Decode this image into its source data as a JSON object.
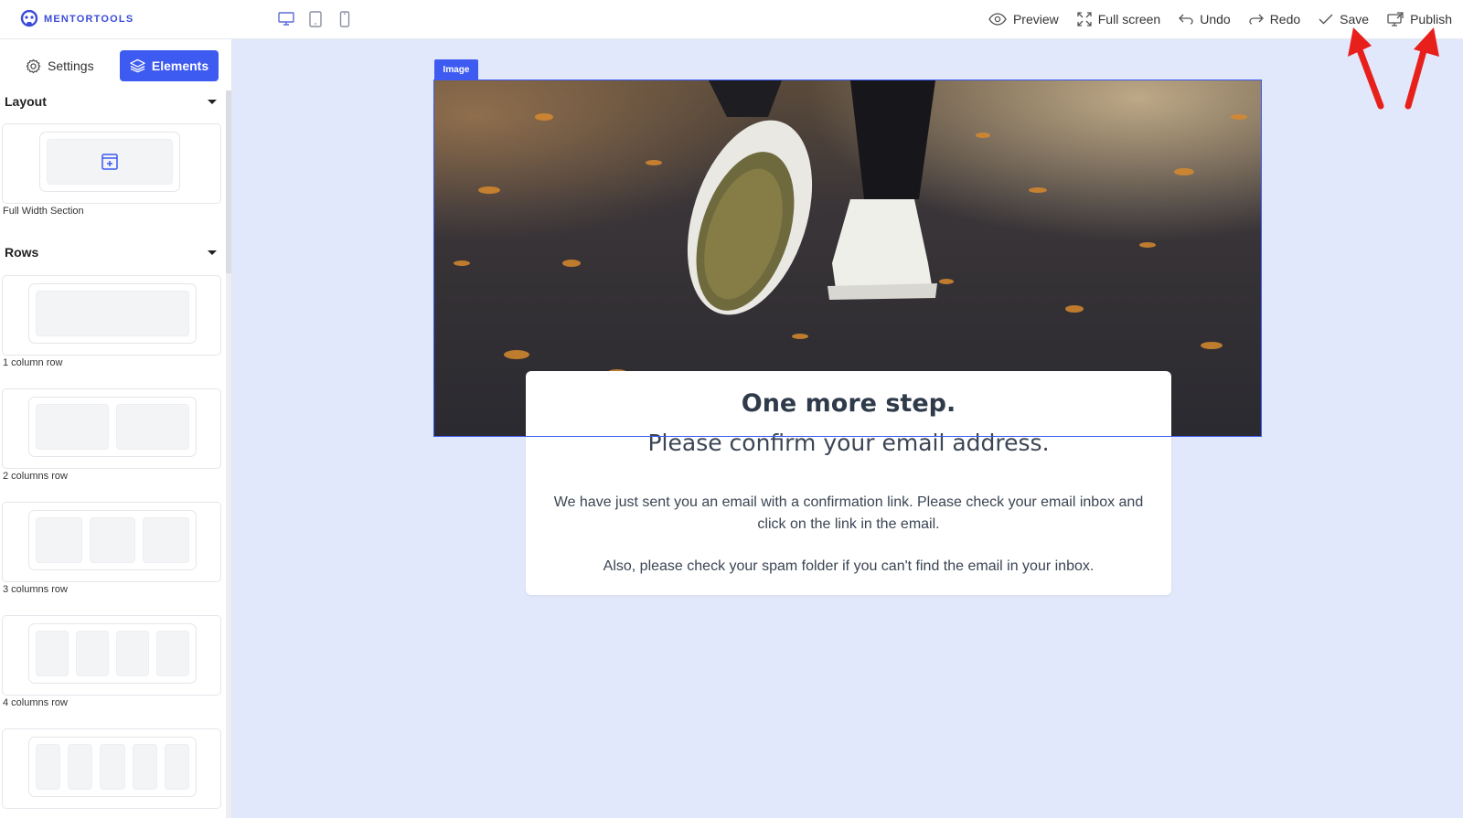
{
  "app": {
    "logo_text": "MENTORTOOLS",
    "accent": "#3d5af1"
  },
  "devices": [
    {
      "name": "desktop-icon",
      "active": true
    },
    {
      "name": "tablet-icon",
      "active": false
    },
    {
      "name": "mobile-icon",
      "active": false
    }
  ],
  "toolbar": {
    "preview": "Preview",
    "fullscreen": "Full screen",
    "undo": "Undo",
    "redo": "Redo",
    "save": "Save",
    "publish": "Publish"
  },
  "sidebar": {
    "tabs": {
      "settings": "Settings",
      "elements": "Elements"
    },
    "layout": {
      "title": "Layout",
      "items": [
        {
          "label": "Full Width Section"
        }
      ]
    },
    "rows": {
      "title": "Rows",
      "items": [
        {
          "label": "1 column row",
          "columns": 1
        },
        {
          "label": "2 columns row",
          "columns": 2
        },
        {
          "label": "3 columns row",
          "columns": 3
        },
        {
          "label": "4 columns row",
          "columns": 4
        },
        {
          "label": "",
          "columns": 5
        }
      ]
    }
  },
  "canvas": {
    "image_tag": "Image",
    "title": "One more step.",
    "subtitle": "Please confirm your email address.",
    "paragraph1": "We have just sent you an email with a confirmation link. Please check your email inbox and click on the link in the email.",
    "paragraph2": "Also, please check your spam folder if you can't find the email in your inbox."
  },
  "annotation_color": "#e8201c"
}
